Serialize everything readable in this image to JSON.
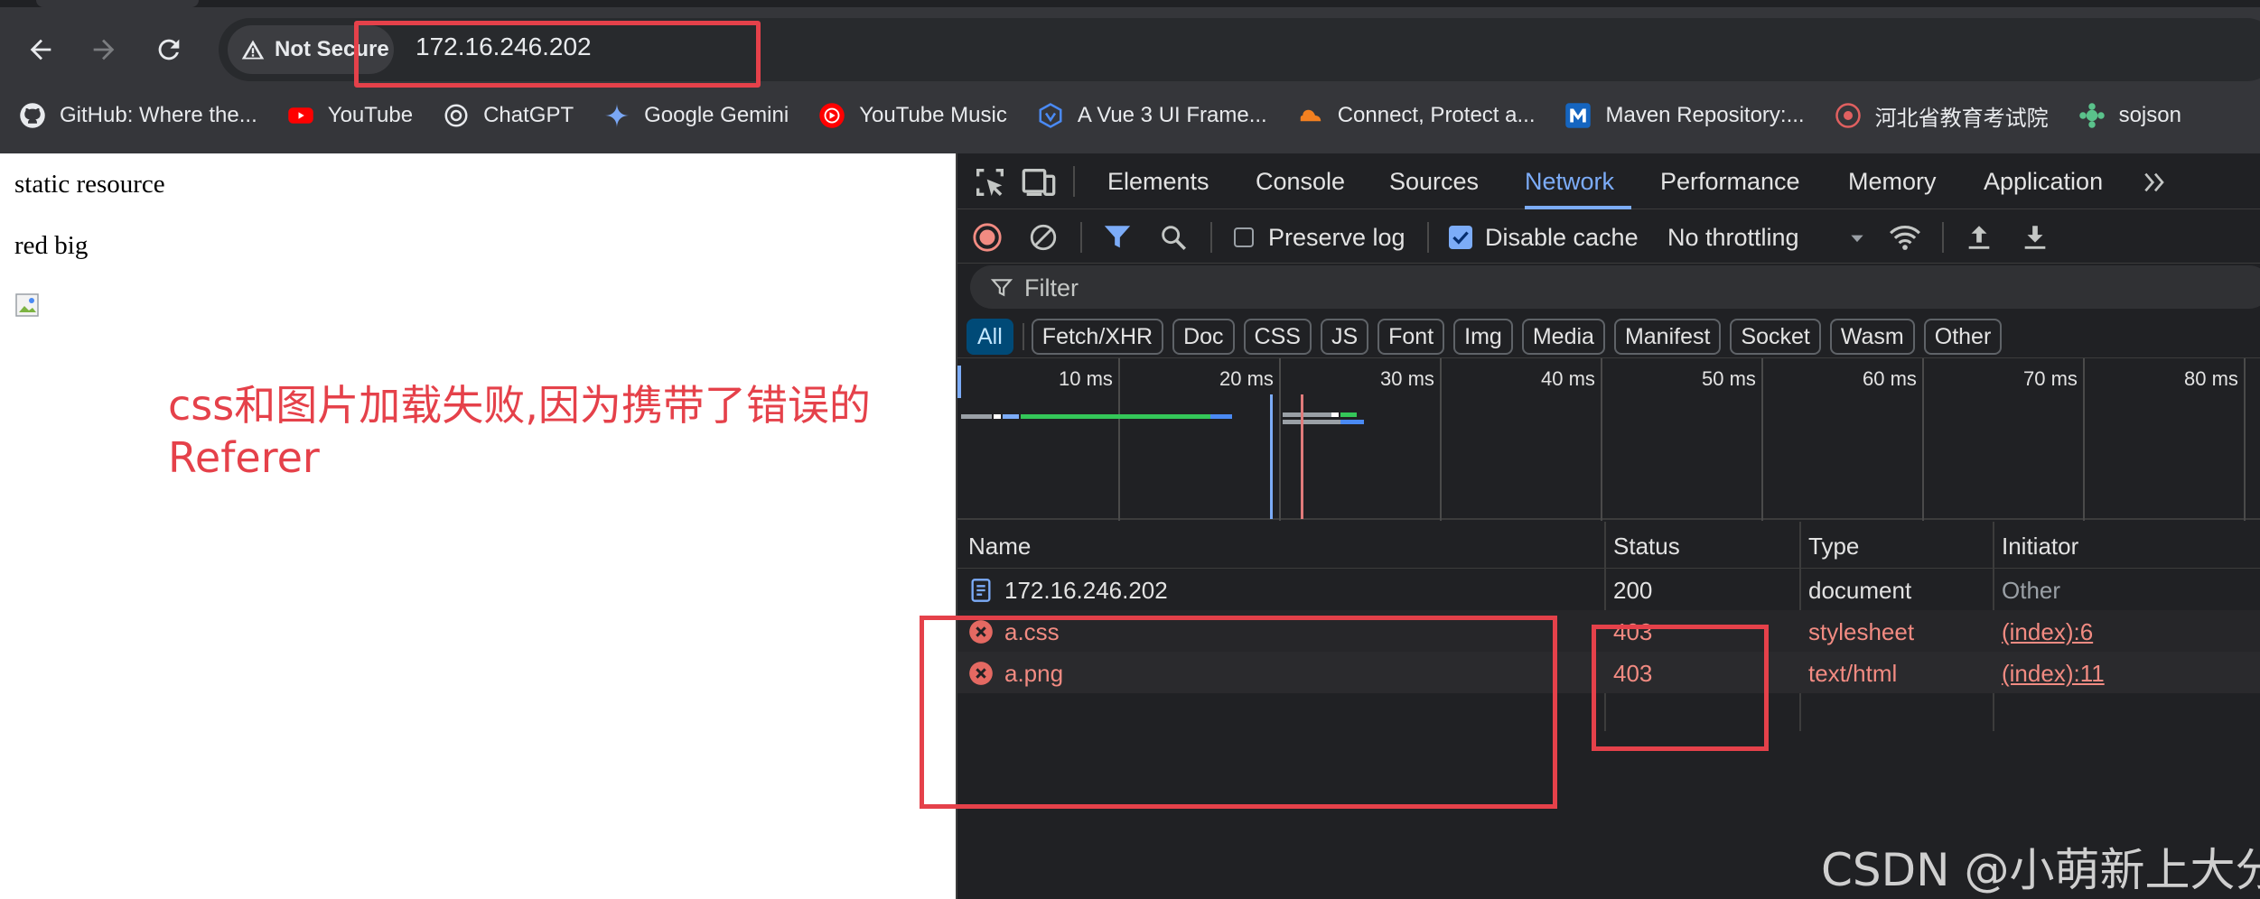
{
  "browser": {
    "security_label": "Not Secure",
    "url": "172.16.246.202",
    "bookmarks": [
      {
        "label": "GitHub: Where the...",
        "icon": "github-icon"
      },
      {
        "label": "YouTube",
        "icon": "youtube-icon"
      },
      {
        "label": "ChatGPT",
        "icon": "chatgpt-icon"
      },
      {
        "label": "Google Gemini",
        "icon": "gemini-icon"
      },
      {
        "label": "YouTube Music",
        "icon": "youtube-music-icon"
      },
      {
        "label": "A Vue 3 UI Frame...",
        "icon": "vue-ui-icon"
      },
      {
        "label": "Connect, Protect a...",
        "icon": "cloudflare-icon"
      },
      {
        "label": "Maven Repository:...",
        "icon": "maven-icon"
      },
      {
        "label": "河北省教育考试院",
        "icon": "hebei-exam-icon"
      },
      {
        "label": "sojson",
        "icon": "sojson-icon"
      }
    ]
  },
  "page": {
    "line1": "static resource",
    "line2": "red big",
    "annotation": "css和图片加载失败,因为携带了错误的Referer"
  },
  "devtools": {
    "tabs": [
      "Elements",
      "Console",
      "Sources",
      "Network",
      "Performance",
      "Memory",
      "Application"
    ],
    "active_tab": "Network",
    "toolbar": {
      "preserve_log": "Preserve log",
      "preserve_log_checked": false,
      "disable_cache": "Disable cache",
      "disable_cache_checked": true,
      "throttling": "No throttling"
    },
    "filter_placeholder": "Filter",
    "type_filters": [
      "All",
      "Fetch/XHR",
      "Doc",
      "CSS",
      "JS",
      "Font",
      "Img",
      "Media",
      "Manifest",
      "Socket",
      "Wasm",
      "Other"
    ],
    "active_type_filter": "All",
    "timeline_ticks": [
      "10 ms",
      "20 ms",
      "30 ms",
      "40 ms",
      "50 ms",
      "60 ms",
      "70 ms",
      "80 ms"
    ],
    "columns": [
      "Name",
      "Status",
      "Type",
      "Initiator"
    ],
    "requests": [
      {
        "name": "172.16.246.202",
        "status": "200",
        "type": "document",
        "initiator": "Other",
        "error": false
      },
      {
        "name": "a.css",
        "status": "403",
        "type": "stylesheet",
        "initiator": "(index):6",
        "error": true
      },
      {
        "name": "a.png",
        "status": "403",
        "type": "text/html",
        "initiator": "(index):11",
        "error": true
      }
    ]
  },
  "watermark": "CSDN @小萌新上大分",
  "colors": {
    "annotation_red": "#e5414a",
    "error_text": "#f28b82",
    "active_tab_blue": "#7cacf8"
  }
}
